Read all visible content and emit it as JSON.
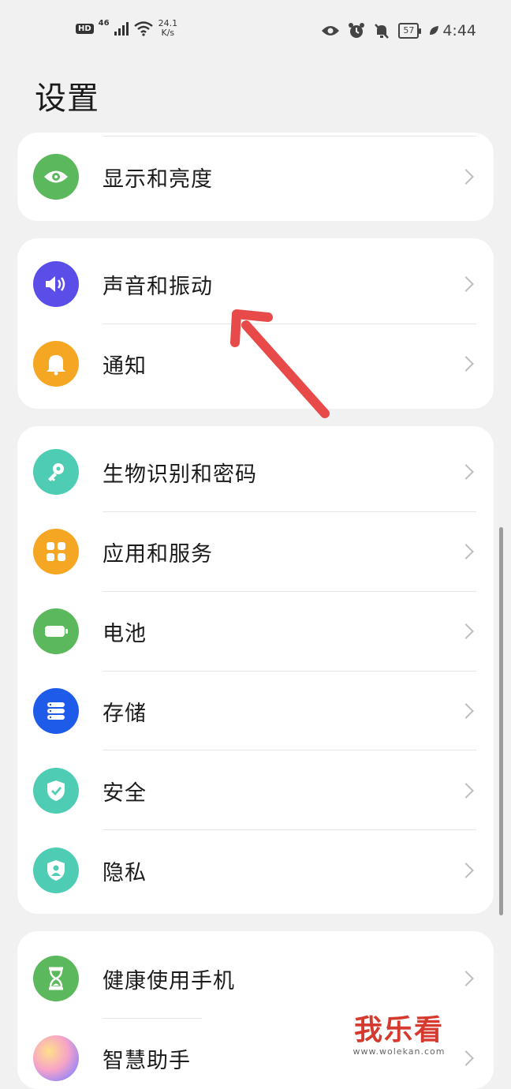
{
  "status_bar": {
    "hd": "HD",
    "network": "46",
    "speed_value": "24.1",
    "speed_unit": "K/s",
    "battery": "57",
    "time": "4:44"
  },
  "title": "设置",
  "groups": [
    {
      "items": [
        {
          "label": "显示和亮度",
          "icon": "eye-icon",
          "color": "#5cb85c"
        }
      ]
    },
    {
      "items": [
        {
          "label": "声音和振动",
          "icon": "speaker-icon",
          "color": "#5b4ee8"
        },
        {
          "label": "通知",
          "icon": "bell-icon",
          "color": "#f5a623"
        }
      ]
    },
    {
      "items": [
        {
          "label": "生物识别和密码",
          "icon": "key-icon",
          "color": "#4ecdb4"
        },
        {
          "label": "应用和服务",
          "icon": "apps-grid-icon",
          "color": "#f5a623"
        },
        {
          "label": "电池",
          "icon": "battery-icon",
          "color": "#5cb85c"
        },
        {
          "label": "存储",
          "icon": "storage-icon",
          "color": "#1e5be8"
        },
        {
          "label": "安全",
          "icon": "shield-check-icon",
          "color": "#4ecdb4"
        },
        {
          "label": "隐私",
          "icon": "privacy-shield-icon",
          "color": "#4ecdb4"
        }
      ]
    },
    {
      "items": [
        {
          "label": "健康使用手机",
          "icon": "hourglass-icon",
          "color": "#5cb85c"
        },
        {
          "label": "智慧助手",
          "icon": "assistant-orb-icon",
          "color": "#e96fb8"
        }
      ]
    }
  ],
  "watermark": {
    "text": "我乐看",
    "url": "www.wolekan.com"
  }
}
